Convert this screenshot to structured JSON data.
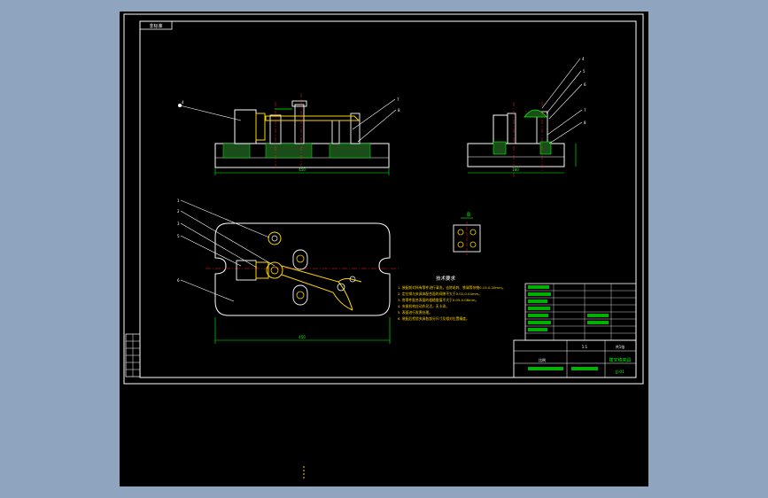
{
  "drawing": {
    "title_tab": "非标准",
    "title_block": {
      "name": "拨叉铣夹具",
      "drawing_no": "JJ-01",
      "scale_label": "比例",
      "scale": "1:1",
      "sheet": "共1张"
    },
    "tech_requirements": {
      "heading": "技术要求",
      "lines": [
        "1. 装配前对所有零件进行清洗，去除毛刺、铁屑等杂物0.15-0.20mm。",
        "2. 定位销与夹具体配合面的间隙不大于0.02-0.04mm。",
        "3. 各零件配合表面的粗糙度值不大于0.05-0.08mm。",
        "4. 夹紧机构应动作灵活，无卡滞。",
        "5. 表面进行发黑处理。",
        "6. 装配后检验夹具各部分尺寸及相对位置精度。"
      ]
    },
    "section_marker": "B",
    "dims": {
      "front_width": "450",
      "plan_width": "450",
      "side_width": "180"
    },
    "balloons_front_left": [
      "4"
    ],
    "balloons_front_right": [
      "7",
      "8"
    ],
    "balloons_side": [
      "4",
      "5",
      "6",
      "7",
      "8"
    ],
    "balloons_plan": [
      "1",
      "2",
      "3",
      "5",
      "6"
    ],
    "colors": {
      "canvas": "#8ea4bf",
      "sheet": "#000000",
      "line": "#ffffff",
      "dim": "#00ff00",
      "part": "#ffd400",
      "center": "#ff2020"
    }
  }
}
